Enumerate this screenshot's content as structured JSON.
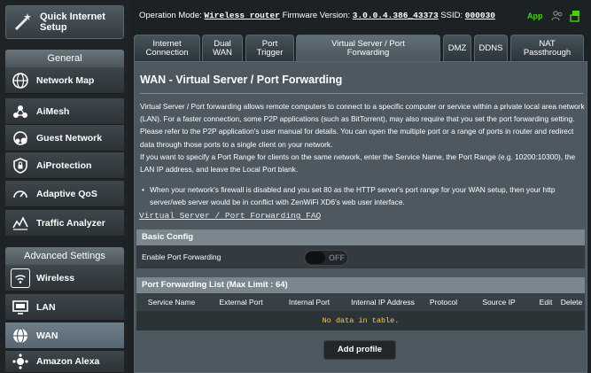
{
  "sidebar": {
    "quick_setup_label": "Quick Internet\nSetup",
    "general_label": "General",
    "general_items": [
      {
        "label": "Network Map",
        "icon": "globe-network-icon"
      },
      {
        "label": "AiMesh",
        "icon": "aimesh-icon"
      },
      {
        "label": "Guest Network",
        "icon": "guest-network-icon"
      },
      {
        "label": "AiProtection",
        "icon": "shield-lock-icon"
      },
      {
        "label": "Adaptive QoS",
        "icon": "speedometer-icon"
      },
      {
        "label": "Traffic Analyzer",
        "icon": "traffic-chart-icon"
      }
    ],
    "advanced_label": "Advanced Settings",
    "advanced_items": [
      {
        "label": "Wireless",
        "icon": "wifi-icon"
      },
      {
        "label": "LAN",
        "icon": "monitor-icon"
      },
      {
        "label": "WAN",
        "icon": "wan-globe-icon",
        "active": true
      },
      {
        "label": "Amazon Alexa",
        "icon": "alexa-icon"
      }
    ]
  },
  "topbar": {
    "op_mode_label": "Operation Mode:",
    "op_mode_value": "Wireless router",
    "firmware_label": "Firmware Version:",
    "firmware_value": "3.0.0.4.386_43373",
    "ssid_label": "SSID:",
    "ssid_value": "000030",
    "app_label": "App",
    "accent_green": "#46d40f"
  },
  "tabs": [
    {
      "label": "Internet\nConnection"
    },
    {
      "label": "Dual\nWAN"
    },
    {
      "label": "Port\nTrigger"
    },
    {
      "label": "Virtual Server / Port\nForwarding",
      "active": true
    },
    {
      "label": "DMZ"
    },
    {
      "label": "DDNS"
    },
    {
      "label": "NAT\nPassthrough"
    }
  ],
  "content": {
    "title": "WAN - Virtual Server / Port Forwarding",
    "description": "Virtual Server / Port forwarding allows remote computers to connect to a specific computer or service within a private local area network (LAN). For a faster connection, some P2P applications (such as BitTorrent), may also require that you set the port forwarding setting. Please refer to the P2P application's user manual for details. You can open the multiple port or a range of ports in router and redirect data through those ports to a single client on your network.",
    "description2": "If you want to specify a Port Range for clients on the same network, enter the Service Name, the Port Range (e.g. 10200:10300), the LAN IP address, and leave the Local Port blank.",
    "bullet": "When your network's firewall is disabled and you set 80 as the HTTP server's port range for your WAN setup, then your http server/web server would be in conflict with ZenWiFi XD6's web user interface.",
    "faq_link": "Virtual Server / Port Forwarding FAQ",
    "basic_config": {
      "header": "Basic Config",
      "enable_label": "Enable Port Forwarding",
      "toggle_state": "OFF"
    },
    "list": {
      "header": "Port Forwarding List (Max Limit : 64)",
      "columns": [
        "Service Name",
        "External Port",
        "Internal Port",
        "Internal IP Address",
        "Protocol",
        "Source IP",
        "Edit",
        "Delete"
      ],
      "empty_text": "No data in table."
    },
    "add_button": "Add profile"
  }
}
